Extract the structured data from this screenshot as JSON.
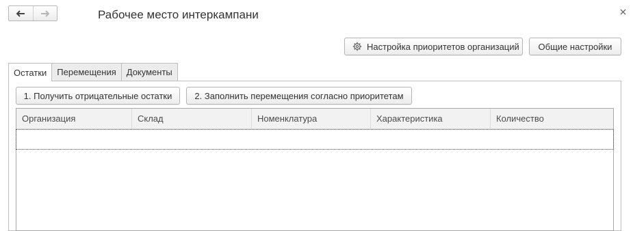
{
  "window": {
    "title": "Рабочее место интеркампани"
  },
  "toolbar": {
    "priority_settings_label": "Настройка приоритетов организаций",
    "general_settings_label": "Общие настройки"
  },
  "tabs": [
    {
      "label": "Остатки",
      "active": true
    },
    {
      "label": "Перемещения",
      "active": false
    },
    {
      "label": "Документы",
      "active": false
    }
  ],
  "actions": {
    "get_negative_label": "1. Получить отрицательные остатки",
    "fill_movements_label": "2. Заполнить перемещения согласно приоритетам"
  },
  "table": {
    "columns": [
      "Организация",
      "Склад",
      "Номенклатура",
      "Характеристика",
      "Количество"
    ],
    "rows": []
  },
  "icons": {
    "back": "arrow-left-icon",
    "forward": "arrow-right-icon",
    "close": "close-icon",
    "settings": "gear-icon"
  }
}
